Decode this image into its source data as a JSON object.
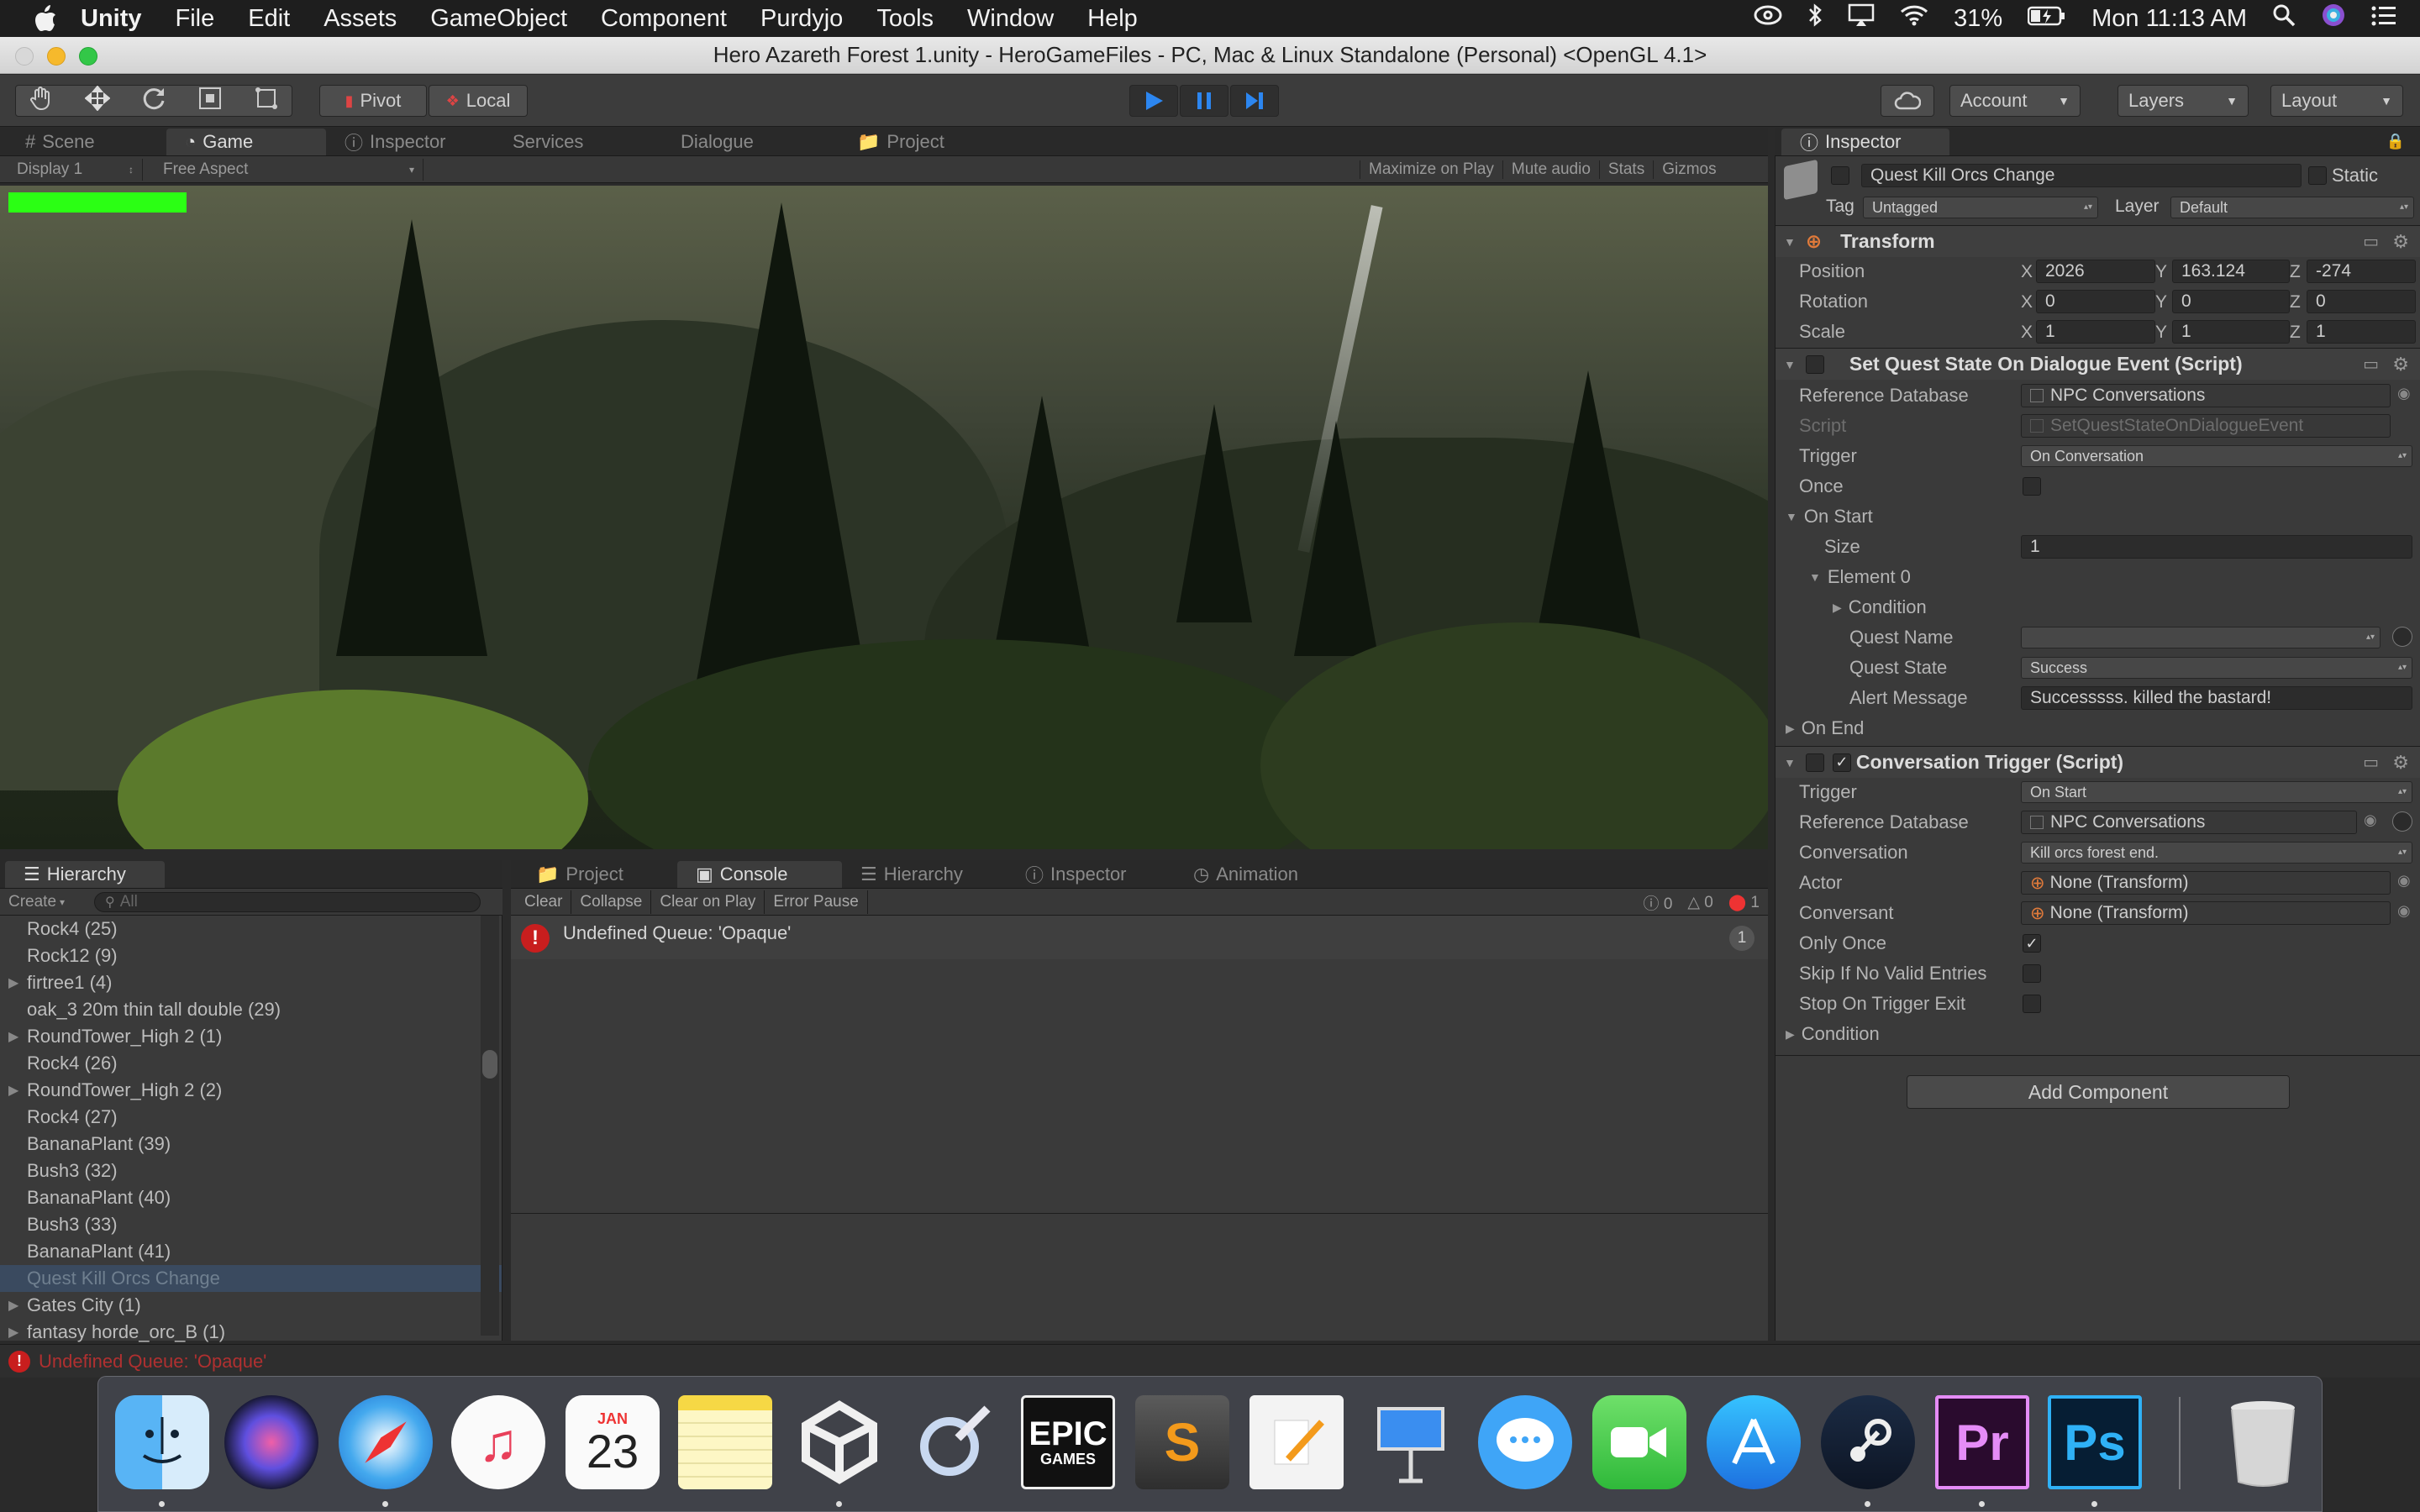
{
  "menubar": {
    "items": [
      "Unity",
      "File",
      "Edit",
      "Assets",
      "GameObject",
      "Component",
      "Purdyjo",
      "Tools",
      "Window",
      "Help"
    ],
    "battery": "31%",
    "clock": "Mon 11:13 AM"
  },
  "window": {
    "title": "Hero Azareth Forest 1.unity - HeroGameFiles - PC, Mac & Linux Standalone (Personal) <OpenGL 4.1>"
  },
  "toolbar": {
    "pivot": "Pivot",
    "local": "Local",
    "account": "Account",
    "layers": "Layers",
    "layout": "Layout"
  },
  "center_tabs": [
    "Scene",
    "Game",
    "Inspector",
    "Services",
    "Dialogue",
    "Project"
  ],
  "game_bar": {
    "display": "Display 1",
    "aspect": "Free Aspect",
    "options": [
      "Maximize on Play",
      "Mute audio",
      "Stats",
      "Gizmos"
    ]
  },
  "hierarchy": {
    "tab": "Hierarchy",
    "create": "Create",
    "search_placeholder": "All",
    "items": [
      {
        "label": "Rock4 (25)",
        "arrow": ""
      },
      {
        "label": "Rock12 (9)",
        "arrow": ""
      },
      {
        "label": "firtree1 (4)",
        "arrow": "▶"
      },
      {
        "label": "oak_3 20m thin tall double (29)",
        "arrow": ""
      },
      {
        "label": "RoundTower_High 2 (1)",
        "arrow": "▶"
      },
      {
        "label": "Rock4 (26)",
        "arrow": ""
      },
      {
        "label": "RoundTower_High 2 (2)",
        "arrow": "▶"
      },
      {
        "label": "Rock4 (27)",
        "arrow": ""
      },
      {
        "label": "BananaPlant (39)",
        "arrow": ""
      },
      {
        "label": "Bush3 (32)",
        "arrow": ""
      },
      {
        "label": "BananaPlant (40)",
        "arrow": ""
      },
      {
        "label": "Bush3 (33)",
        "arrow": ""
      },
      {
        "label": "BananaPlant (41)",
        "arrow": ""
      },
      {
        "label": "Quest Kill Orcs Change",
        "arrow": ""
      },
      {
        "label": "Gates City (1)",
        "arrow": "▶"
      },
      {
        "label": "fantasy horde_orc_B (1)",
        "arrow": "▶"
      }
    ]
  },
  "console": {
    "tabs": [
      "Project",
      "Console",
      "Hierarchy",
      "Inspector",
      "Animation"
    ],
    "buttons": [
      "Clear",
      "Collapse",
      "Clear on Play",
      "Error Pause"
    ],
    "counts": {
      "log": "0",
      "warn": "0",
      "error": "1"
    },
    "message": "Undefined Queue: 'Opaque'",
    "message_count": "1"
  },
  "inspector": {
    "tab": "Inspector",
    "object_name": "Quest Kill Orcs Change",
    "static_label": "Static",
    "tag_label": "Tag",
    "tag": "Untagged",
    "layer_label": "Layer",
    "layer": "Default",
    "transform": {
      "title": "Transform",
      "position_label": "Position",
      "rotation_label": "Rotation",
      "scale_label": "Scale",
      "position": {
        "x": "2026",
        "y": "163.124",
        "z": "-274"
      },
      "rotation": {
        "x": "0",
        "y": "0",
        "z": "0"
      },
      "scale": {
        "x": "1",
        "y": "1",
        "z": "1"
      }
    },
    "sqs": {
      "title": "Set Quest State On Dialogue Event (Script)",
      "ref_db_label": "Reference Database",
      "ref_db": "NPC Conversations",
      "script_label": "Script",
      "script": "SetQuestStateOnDialogueEvent",
      "trigger_label": "Trigger",
      "trigger": "On Conversation",
      "once_label": "Once",
      "on_start_label": "On Start",
      "size_label": "Size",
      "size": "1",
      "element_label": "Element 0",
      "condition_label": "Condition",
      "quest_name_label": "Quest Name",
      "quest_name": "",
      "quest_state_label": "Quest State",
      "quest_state": "Success",
      "alert_label": "Alert Message",
      "alert": "Successsss. killed the bastard!",
      "on_end_label": "On End"
    },
    "ct": {
      "title": "Conversation Trigger (Script)",
      "trigger_label": "Trigger",
      "trigger": "On Start",
      "ref_db_label": "Reference Database",
      "ref_db": "NPC Conversations",
      "conversation_label": "Conversation",
      "conversation": "Kill orcs forest end.",
      "actor_label": "Actor",
      "actor": "None (Transform)",
      "conversant_label": "Conversant",
      "conversant": "None (Transform)",
      "only_once_label": "Only Once",
      "skip_label": "Skip If No Valid Entries",
      "stop_label": "Stop On Trigger Exit",
      "condition_label": "Condition"
    },
    "add_component": "Add Component"
  },
  "status": {
    "message": "Undefined Queue: 'Opaque'"
  },
  "dock": {
    "calendar_month": "JAN",
    "calendar_day": "23",
    "epic_line1": "EPIC",
    "epic_line2": "GAMES",
    "premiere": "Pr",
    "photoshop": "Ps"
  }
}
